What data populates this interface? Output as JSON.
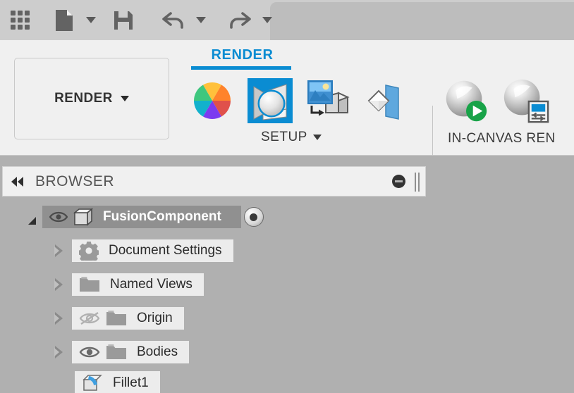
{
  "quick_access": {
    "items": [
      {
        "name": "app-grid",
        "icon": "grid-icon",
        "label": "",
        "has_caret": false
      },
      {
        "name": "new-document",
        "icon": "document-icon",
        "label": "",
        "has_caret": true
      },
      {
        "name": "save",
        "icon": "save-icon",
        "label": "",
        "has_caret": false
      },
      {
        "name": "undo",
        "icon": "undo-arrow-icon",
        "label": "",
        "has_caret": true
      },
      {
        "name": "redo",
        "icon": "redo-arrow-icon",
        "label": "",
        "has_caret": true
      }
    ]
  },
  "ribbon": {
    "workspace_dropdown": {
      "label": "RENDER",
      "caret": "chevron-down-icon"
    },
    "active_tab": {
      "label": "RENDER",
      "accent_color": "#0a8cd2"
    },
    "panels": [
      {
        "name": "setup",
        "title": "SETUP",
        "has_dropdown": true,
        "buttons": [
          {
            "name": "appearance",
            "icon": "color-wheel-icon",
            "selected": false
          },
          {
            "name": "scene-settings",
            "icon": "render-cube-sphere-icon",
            "selected": true
          },
          {
            "name": "decal",
            "icon": "decal-image-cube-icon",
            "selected": false
          },
          {
            "name": "texture-map-controls",
            "icon": "diamond-plane-icon",
            "selected": false
          }
        ]
      },
      {
        "name": "in-canvas-render",
        "title": "IN-CANVAS REN",
        "has_dropdown": false,
        "buttons": [
          {
            "name": "in-canvas-render",
            "icon": "sphere-play-icon",
            "selected": false
          },
          {
            "name": "in-canvas-render-settings",
            "icon": "sphere-settings-icon",
            "selected": false
          }
        ]
      }
    ]
  },
  "browser": {
    "title": "BROWSER",
    "collapse_icon": "double-chevron-left-icon",
    "minimize_icon": "minimize-circle-icon",
    "resize_grip": "vertical-grip-icon",
    "tree": [
      {
        "label": "FusionComponent",
        "indent": 0,
        "twisty": "expanded",
        "visibility_icon": "eye-visible-icon",
        "node_icon": "component-cube-icon",
        "selected": true,
        "activate_icon": "activate-radio-icon"
      },
      {
        "label": "Document Settings",
        "indent": 1,
        "twisty": "collapsed",
        "visibility_icon": "none",
        "node_icon": "gear-icon",
        "selected": false,
        "activate_icon": "none"
      },
      {
        "label": "Named Views",
        "indent": 1,
        "twisty": "collapsed",
        "visibility_icon": "none",
        "node_icon": "folder-icon",
        "selected": false,
        "activate_icon": "none"
      },
      {
        "label": "Origin",
        "indent": 1,
        "twisty": "collapsed",
        "visibility_icon": "eye-hidden-icon",
        "node_icon": "folder-icon",
        "selected": false,
        "activate_icon": "none"
      },
      {
        "label": "Bodies",
        "indent": 1,
        "twisty": "collapsed",
        "visibility_icon": "eye-visible-icon",
        "node_icon": "folder-icon",
        "selected": false,
        "activate_icon": "none"
      },
      {
        "label": "Fillet1",
        "indent": 1,
        "twisty": "none",
        "visibility_icon": "none",
        "node_icon": "fillet-icon",
        "selected": false,
        "activate_icon": "none"
      }
    ]
  },
  "colors": {
    "accent_blue": "#0a8cd2",
    "toolbar_gray": "#cdcdcd",
    "ribbon_gray": "#f0f0f0",
    "browser_bg": "#b0b0b0",
    "row_bg": "#ececec",
    "selected_row_bg": "#909090"
  }
}
